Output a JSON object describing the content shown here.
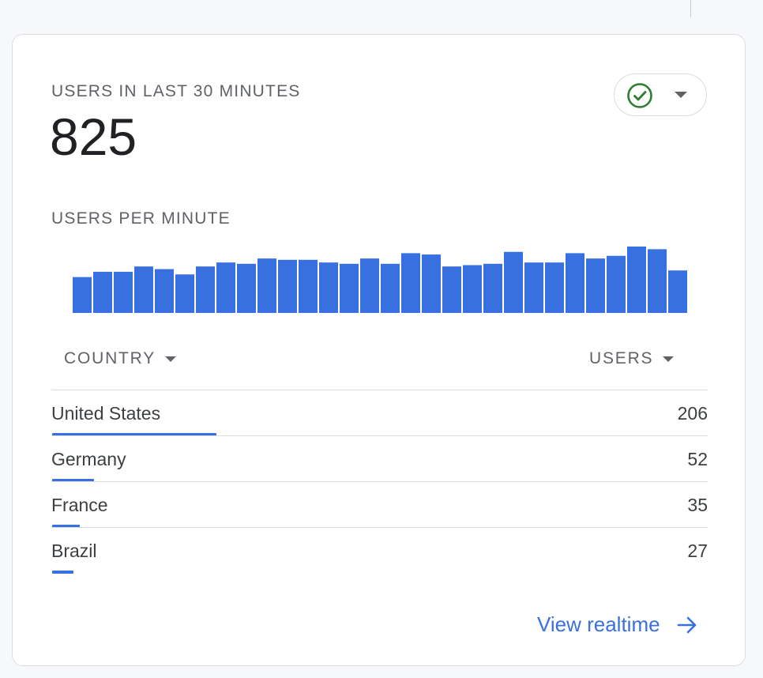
{
  "card": {
    "metric_label": "USERS IN LAST 30 MINUTES",
    "metric_value": "825",
    "status_icon": "check-circle-icon",
    "status_color": "#2e7d32",
    "chart_label": "USERS PER MINUTE",
    "accent_color": "#3870e0",
    "link_label": "View realtime",
    "link_icon": "arrow-right-icon"
  },
  "table": {
    "country_header": "COUNTRY",
    "users_header": "USERS",
    "rows": [
      {
        "country": "United States",
        "users": "206",
        "share": 206
      },
      {
        "country": "Germany",
        "users": "52",
        "share": 52
      },
      {
        "country": "France",
        "users": "35",
        "share": 35
      },
      {
        "country": "Brazil",
        "users": "27",
        "share": 27
      }
    ]
  },
  "chart_data": {
    "type": "bar",
    "title": "USERS PER MINUTE",
    "xlabel": "",
    "ylabel": "",
    "grid": false,
    "ylim": [
      0,
      50
    ],
    "values": [
      27,
      31,
      31,
      35,
      33,
      29,
      35,
      38,
      37,
      41,
      40,
      40,
      38,
      37,
      41,
      37,
      45,
      44,
      35,
      36,
      37,
      46,
      38,
      38,
      45,
      41,
      43,
      51,
      48,
      32
    ]
  }
}
